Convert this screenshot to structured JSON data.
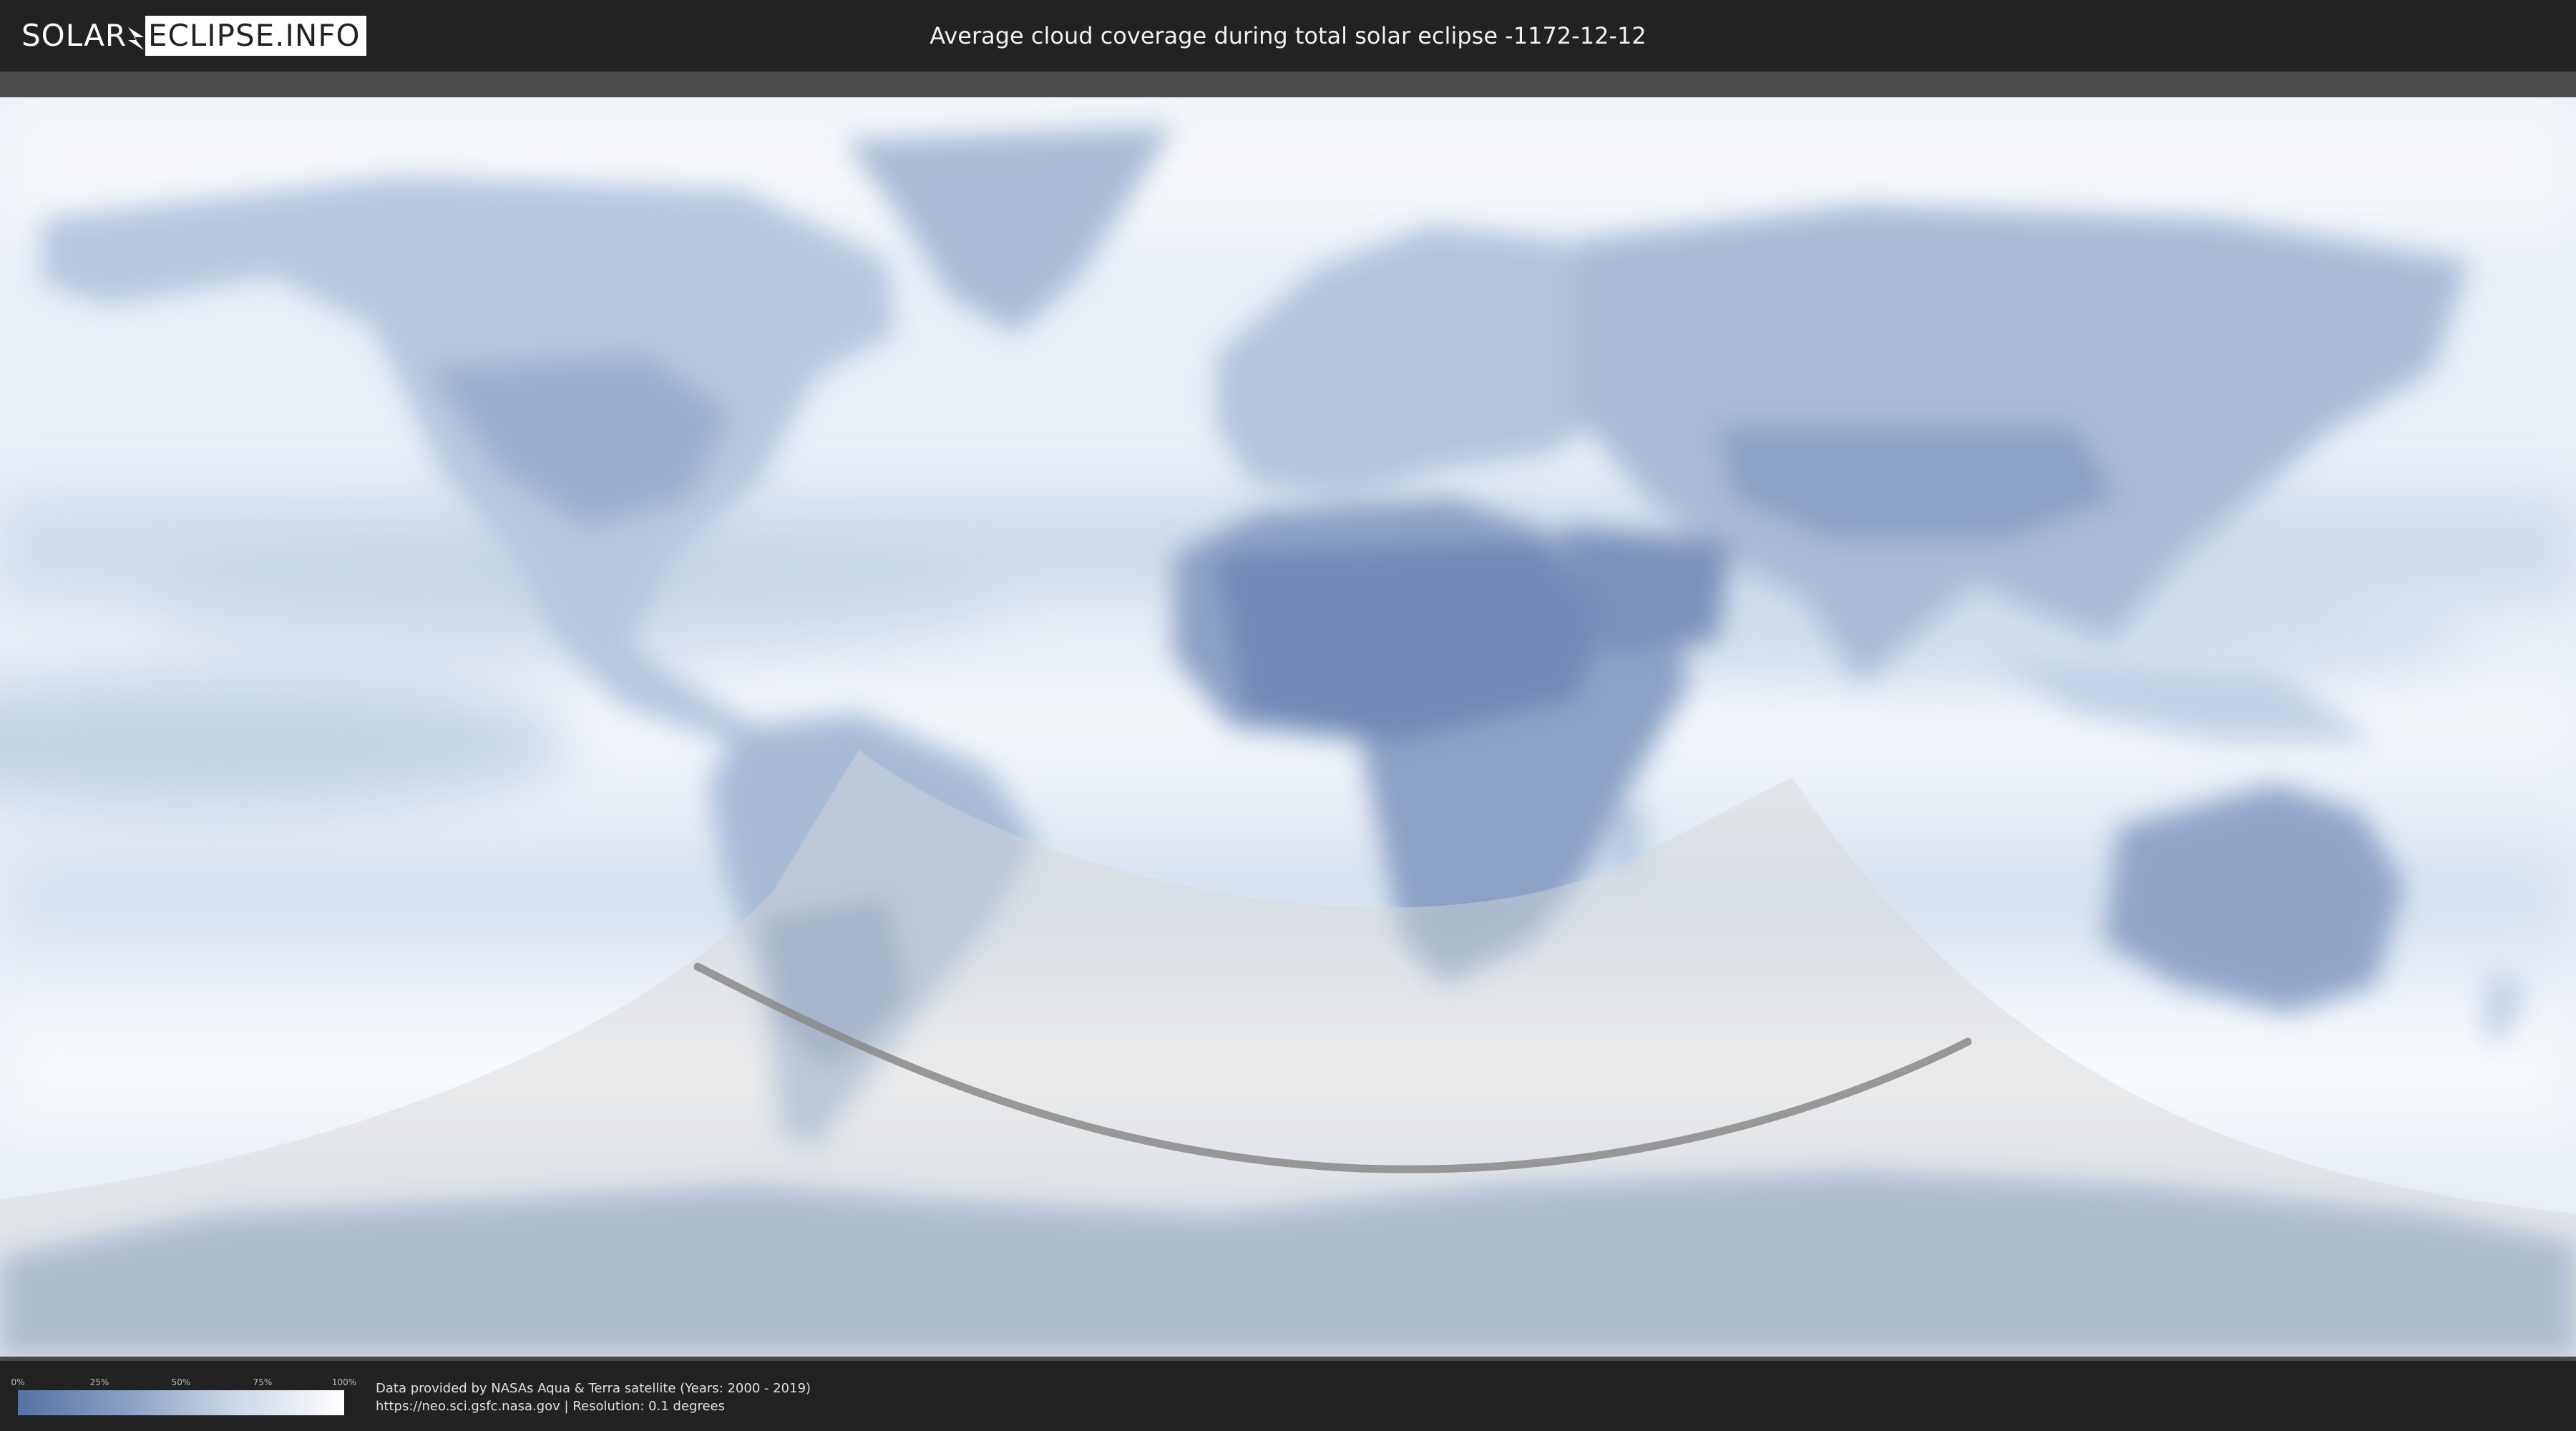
{
  "header": {
    "logo_solar": "SOLAR",
    "logo_eclipse": "ECLIPSE.INFO",
    "title": "Average cloud coverage during total solar eclipse -1172-12-12"
  },
  "legend": {
    "ticks": [
      "0%",
      "25%",
      "50%",
      "75%",
      "100%"
    ],
    "gradient_colors": [
      "#5572a3",
      "#8ca3c6",
      "#c9d5e6",
      "#ffffff"
    ]
  },
  "footer": {
    "credit_line1": "Data provided by NASAs Aqua & Terra satellite (Years: 2000 - 2019)",
    "credit_line2": "https://neo.sci.gsfc.nasa.gov | Resolution: 0.1 degrees"
  },
  "colors": {
    "background": "#222222",
    "ocean_clouds": "#e9eff7",
    "land_clear": "#7b95be",
    "eclipse_shadow": "#d8d8d8",
    "central_line": "#8a8a8a"
  }
}
